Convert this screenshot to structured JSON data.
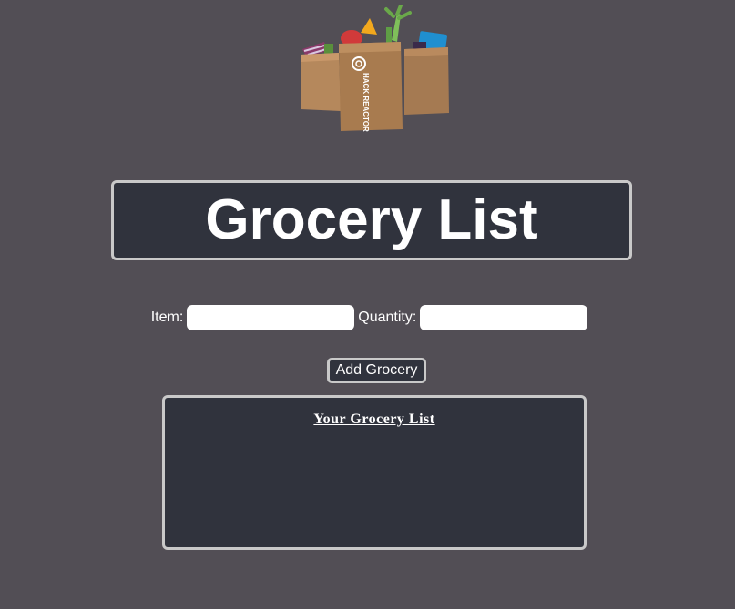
{
  "logo": {
    "icon": "grocery-bags-icon",
    "bag_text": "HACK REACTOR"
  },
  "header": {
    "title": "Grocery List"
  },
  "form": {
    "item_label": "Item:",
    "item_value": "",
    "quantity_label": "Quantity:",
    "quantity_value": "",
    "add_button_label": "Add Grocery"
  },
  "list": {
    "title": "Your Grocery List",
    "items": []
  },
  "colors": {
    "background": "#524e55",
    "panel": "#30333d",
    "border": "#c9c9c9",
    "text": "#ffffff"
  }
}
